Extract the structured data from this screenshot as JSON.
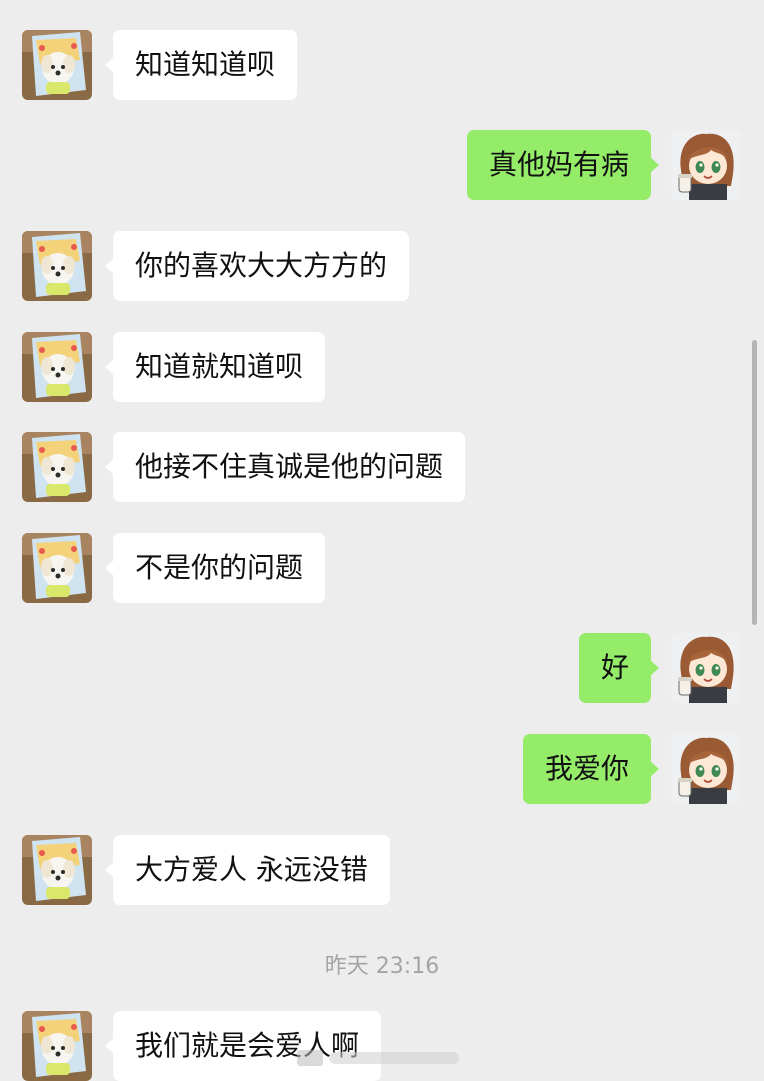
{
  "messages": [
    {
      "side": "in",
      "text": "知道知道呗"
    },
    {
      "side": "out",
      "text": "真他妈有病"
    },
    {
      "side": "in",
      "text": "你的喜欢大大方方的"
    },
    {
      "side": "in",
      "text": "知道就知道呗"
    },
    {
      "side": "in",
      "text": "他接不住真诚是他的问题"
    },
    {
      "side": "in",
      "text": "不是你的问题"
    },
    {
      "side": "out",
      "text": "好"
    },
    {
      "side": "out",
      "text": "我爱你"
    },
    {
      "side": "in",
      "text": "大方爱人 永远没错"
    },
    {
      "side": "in",
      "text": "我们就是会爱人啊"
    }
  ],
  "timestamp": "昨天 23:16",
  "colors": {
    "background": "#ededed",
    "incoming_bubble": "#ffffff",
    "outgoing_bubble": "#95ec69"
  },
  "avatars": {
    "contact": "puppy-photo-avatar",
    "self": "anime-girl-avatar"
  }
}
